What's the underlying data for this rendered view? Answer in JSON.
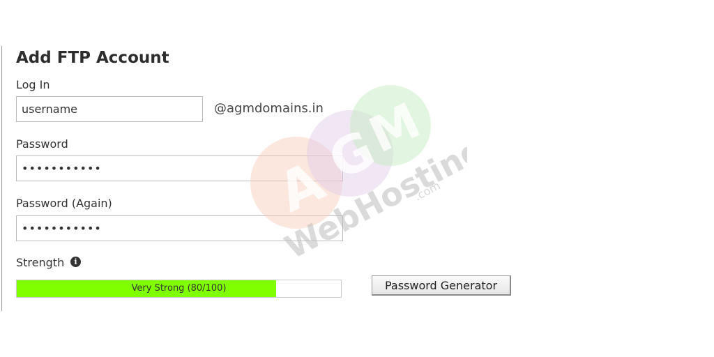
{
  "form": {
    "title": "Add FTP Account",
    "login_label": "Log In",
    "login_value": "username",
    "domain_suffix": "@agmdomains.in",
    "password_label": "Password",
    "password_value": "•••••••••••",
    "password_again_label": "Password (Again)",
    "password_again_value": "•••••••••••",
    "strength_label": "Strength",
    "strength_info_icon": "info-icon",
    "strength_text": "Very Strong (80/100)",
    "strength_fraction": 0.8,
    "strength_color": "#80ff00",
    "generator_button_label": "Password Generator"
  },
  "watermark": {
    "logo_letters": [
      "A",
      "G",
      "M"
    ],
    "brand_text": "WebHosting",
    "brand_suffix": ".com",
    "colors": [
      "#f6c9b5",
      "#e0c8e6",
      "#c5ecc2"
    ]
  }
}
